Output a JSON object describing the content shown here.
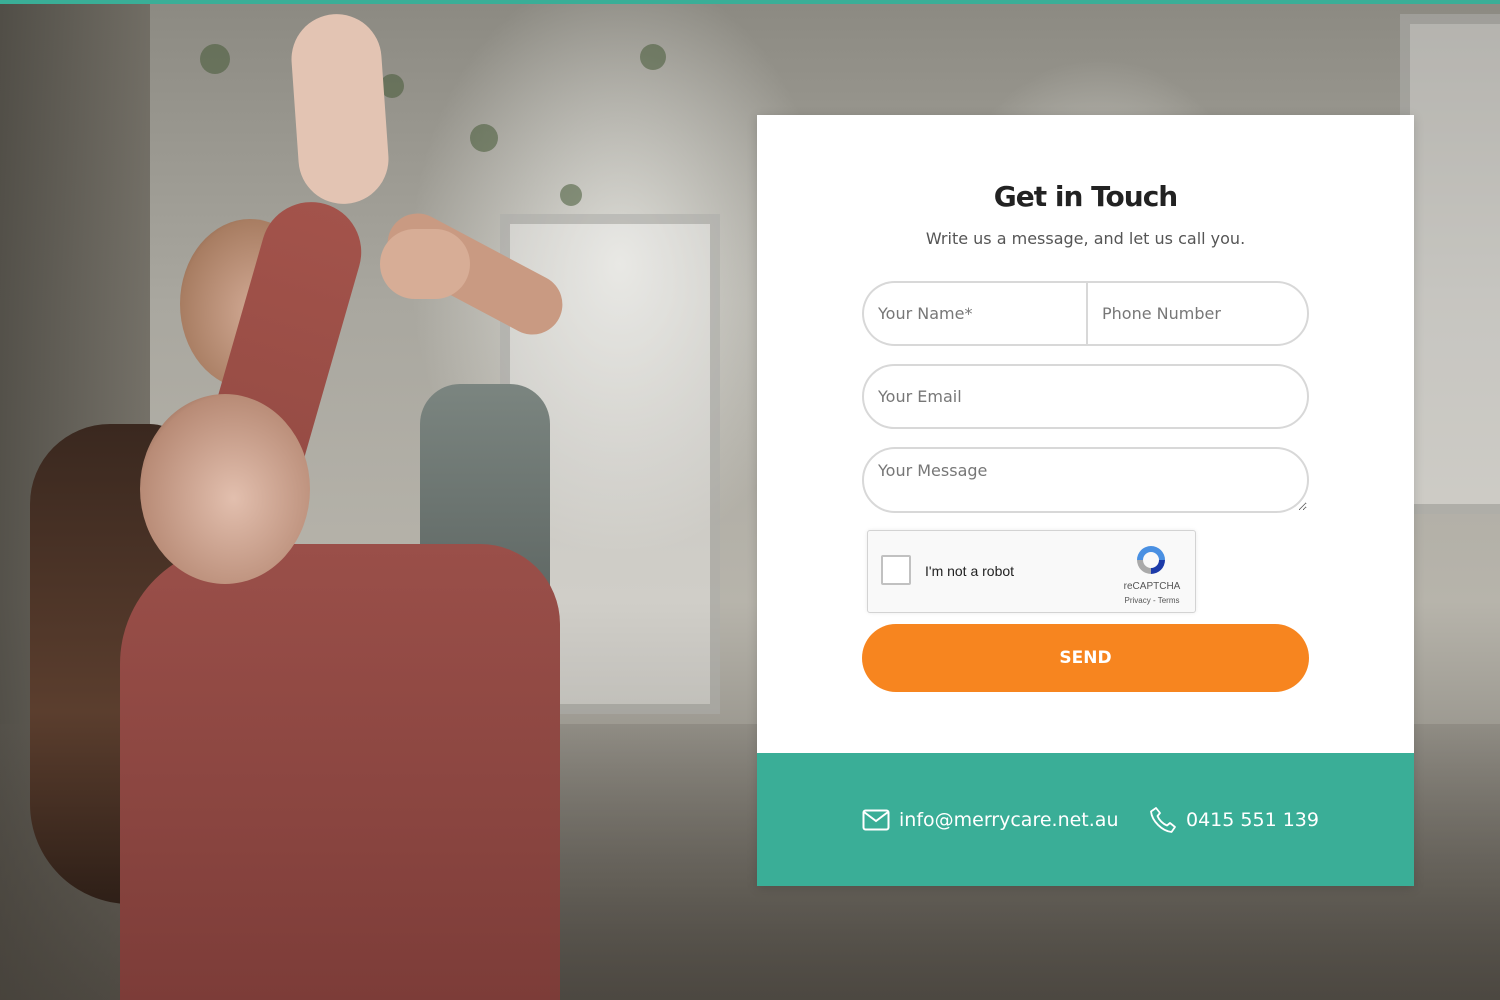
{
  "form": {
    "title": "Get in Touch",
    "subtitle": "Write us a message, and let us call you.",
    "name_placeholder": "Your Name*",
    "phone_placeholder": "Phone Number",
    "email_placeholder": "Your Email",
    "message_placeholder": "Your Message",
    "send_label": "SEND"
  },
  "captcha": {
    "label": "I'm not a robot",
    "brand": "reCAPTCHA",
    "links": "Privacy - Terms"
  },
  "contact": {
    "email": "info@merrycare.net.au",
    "phone": "0415 551 139",
    "email_icon": "envelope-icon",
    "phone_icon": "phone-icon"
  },
  "colors": {
    "accent_teal": "#3aae97",
    "send_orange": "#f7851f"
  }
}
